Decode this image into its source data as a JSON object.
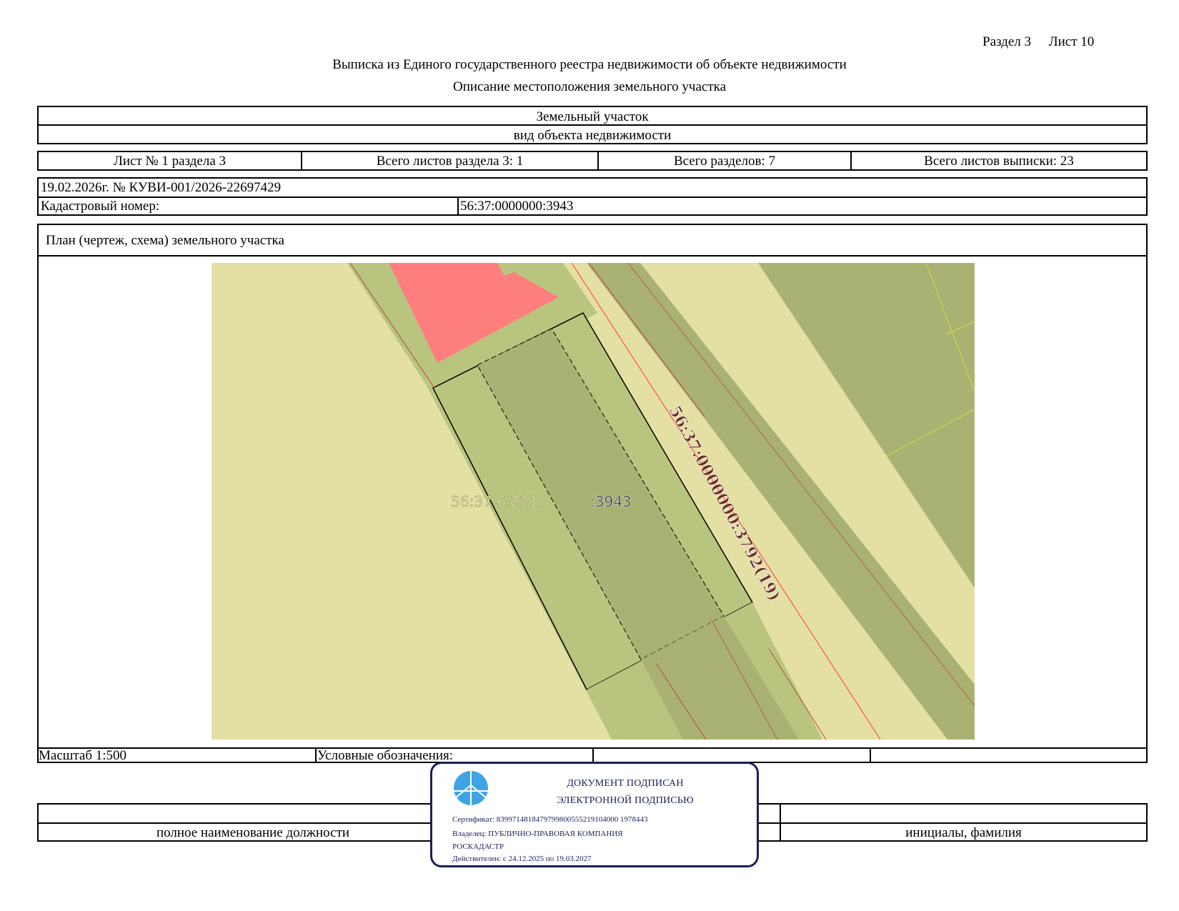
{
  "header": {
    "section": "Раздел 3",
    "sheet": "Лист 10",
    "title": "Выписка из Единого государственного реестра недвижимости об объекте недвижимости",
    "subtitle": "Описание местоположения земельного участка"
  },
  "object": {
    "type_value": "Земельный участок",
    "type_caption": "вид объекта недвижимости"
  },
  "sheet_info": {
    "sheet_of_section": "Лист № 1 раздела 3",
    "total_section_sheets": "Всего листов раздела 3: 1",
    "total_sections": "Всего разделов: 7",
    "total_extract_sheets": "Всего листов выписки: 23"
  },
  "registry": {
    "date_number": "19.02.2026г. № КУВИ-001/2026-22697429",
    "cadastral_label": "Кадастровый номер:",
    "cadastral_value": "56:37:0000000:3943"
  },
  "plan": {
    "heading": "План (чертеж, схема) земельного участка",
    "map_labels": {
      "zone": "56:37-6.221",
      "parcel": ":3943",
      "neighbor": "56:37:0000000:3792(19)"
    },
    "colors": {
      "background": "#e4e0a4",
      "parcel_green": "#b9c57f",
      "parcel_dark": "#a9b272",
      "building": "#ff7f7f",
      "boundary_red": "#ff3b3b",
      "neighbor_label": "#6b2b2b"
    }
  },
  "footer": {
    "scale": "Масштаб 1:500",
    "legend_label": "Условные обозначения:",
    "position_caption": "полное наименование должности",
    "name_caption": "инициалы, фамилия"
  },
  "stamp": {
    "line1": "ДОКУМЕНТ ПОДПИСАН",
    "line2": "ЭЛЕКТРОННОЙ ПОДПИСЬЮ",
    "certificate": "Сертификат: 8399714818479799800555219104000 1978443",
    "owner": "Владелец: ПУБЛИЧНО-ПРАВОВАЯ КОМПАНИЯ",
    "owner_cont": "РОСКАДАСТР",
    "valid": "Действителен: с 24.12.2025 по 19.03.2027",
    "color": "#1a1f5a",
    "logo_color": "#3fa4e6"
  }
}
